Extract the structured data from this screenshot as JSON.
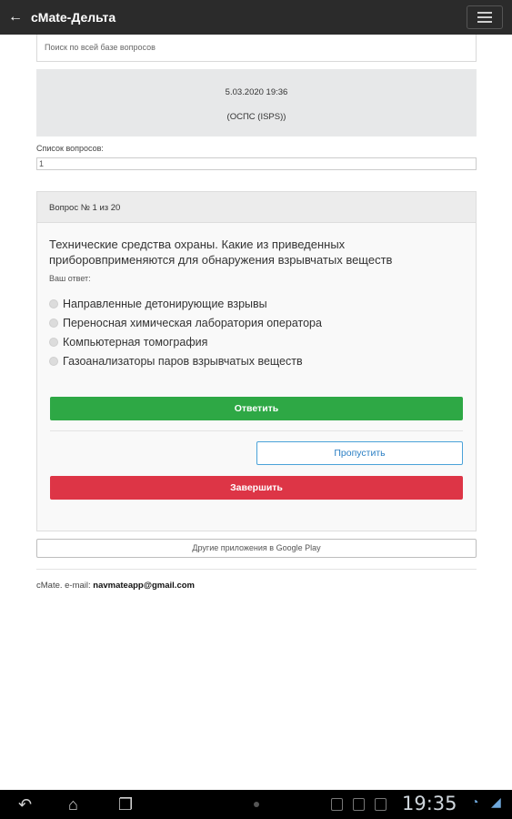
{
  "appbar": {
    "title": "cMate-Дельта"
  },
  "search": {
    "placeholder": "Поиск по всей базе вопросов"
  },
  "info": {
    "datetime": "5.03.2020 19:36",
    "code": "(ОСПС (ISPS))"
  },
  "question_list": {
    "label": "Список вопросов:",
    "selected": "1"
  },
  "question": {
    "header": "Вопрос № 1 из 20",
    "text": "Технические средства охраны. Какие из приведенных приборовприменяются для обнаружения взрывчатых веществ",
    "answer_label": "Ваш ответ:",
    "options": [
      "Направленные детонирующие взрывы",
      "Переносная химическая лаборатория оператора",
      "Компьютерная томография",
      "Газоанализаторы паров взрывчатых веществ"
    ]
  },
  "buttons": {
    "answer": "Ответить",
    "skip": "Пропустить",
    "finish": "Завершить",
    "google_play": "Другие приложения в Google Play"
  },
  "footer": {
    "prefix": "cMate. e-mail: ",
    "email": "navmateapp@gmail.com"
  },
  "statusbar": {
    "time": "19:35"
  },
  "colors": {
    "appbar": "#2b2b2b",
    "answer_button": "#2ea845",
    "finish_button": "#dd3546",
    "skip_border": "#4aa2d9"
  },
  "icons": [
    "back-arrow-icon",
    "menu-icon",
    "nav-back-icon",
    "nav-home-icon",
    "nav-recents-icon",
    "wifi-icon",
    "signal-icon"
  ]
}
